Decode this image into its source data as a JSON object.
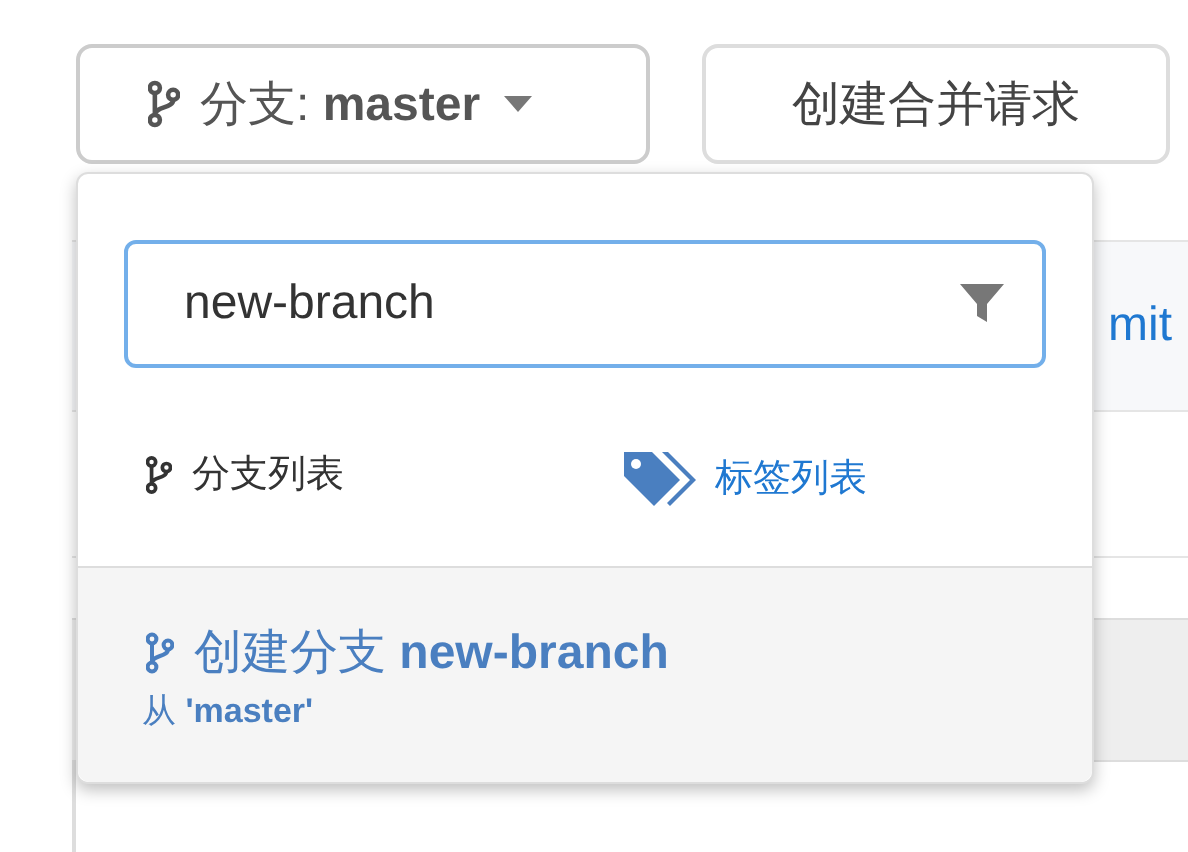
{
  "toolbar": {
    "branch_button": {
      "label": "分支: **master**",
      "open": true
    },
    "merge_request_button": {
      "label": "创建合并请求"
    }
  },
  "background": {
    "cut_link": "mit"
  },
  "dropdown": {
    "search": {
      "value": "new-branch"
    },
    "tabs": [
      {
        "label": "分支列表",
        "kind": "branch",
        "selected": true
      },
      {
        "label": "标签列表",
        "kind": "tag",
        "selected": false
      }
    ],
    "create_item": {
      "title": "创建分支 **new-branch**",
      "subtitle": "从 **'master'**"
    }
  }
}
